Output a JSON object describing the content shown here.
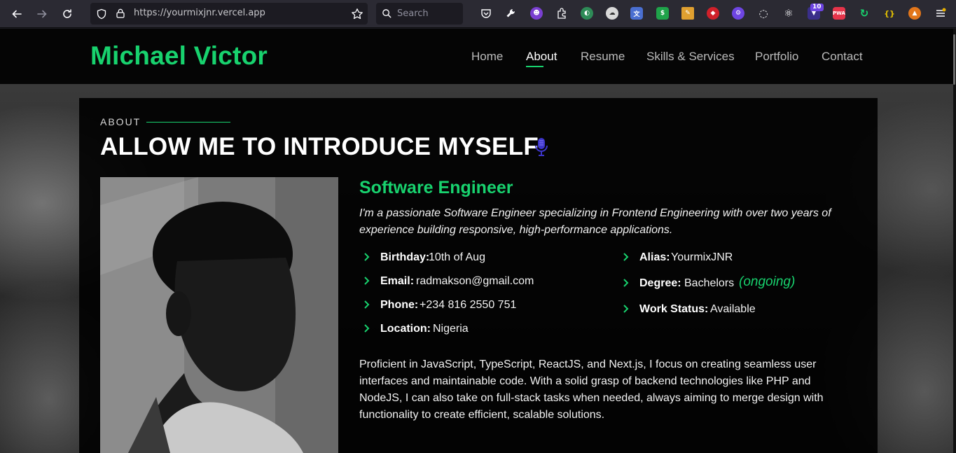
{
  "browser": {
    "url": "https://yourmixjnr.vercel.app",
    "search_placeholder": "Search",
    "extension_badge": "10",
    "extension_pwa_label": "PWA",
    "extension_json_label": "{}"
  },
  "header": {
    "brand": "Michael Victor",
    "nav": [
      {
        "label": "Home"
      },
      {
        "label": "About"
      },
      {
        "label": "Resume"
      },
      {
        "label": "Skills & Services"
      },
      {
        "label": "Portfolio"
      },
      {
        "label": "Contact"
      }
    ],
    "active_nav": "About"
  },
  "about": {
    "section_label": "ABOUT",
    "title": "ALLOW ME TO INTRODUCE MYSELF",
    "role": "Software Engineer",
    "intro": "I'm a passionate Software Engineer specializing in Frontend Engineering with over two years of experience building responsive, high-performance applications.",
    "facts_left": [
      {
        "key": "Birthday:",
        "value": "10th of Aug"
      },
      {
        "key": "Email:",
        "value": "radmakson@gmail.com"
      },
      {
        "key": "Phone:",
        "value": "+234 816 2550 751"
      },
      {
        "key": "Location:",
        "value": "Nigeria"
      }
    ],
    "facts_right": [
      {
        "key": "Alias:",
        "value": "YourmixJNR"
      },
      {
        "key": "Degree:",
        "value": "Bachelors",
        "note": "(ongoing)"
      },
      {
        "key": "Work Status:",
        "value": "Available"
      }
    ],
    "paragraph": "Proficient in JavaScript, TypeScript, ReactJS, and Next.js, I focus on creating seamless user interfaces and maintainable code. With a solid grasp of backend technologies like PHP and NodeJS, I can also take on full-stack tasks when needed, always aiming to merge design with functionality to create efficient, scalable solutions."
  },
  "colors": {
    "accent": "#18d26e",
    "header_bg": "#050505",
    "card_bg": "#000000",
    "chrome_bg": "#2b2a33"
  }
}
